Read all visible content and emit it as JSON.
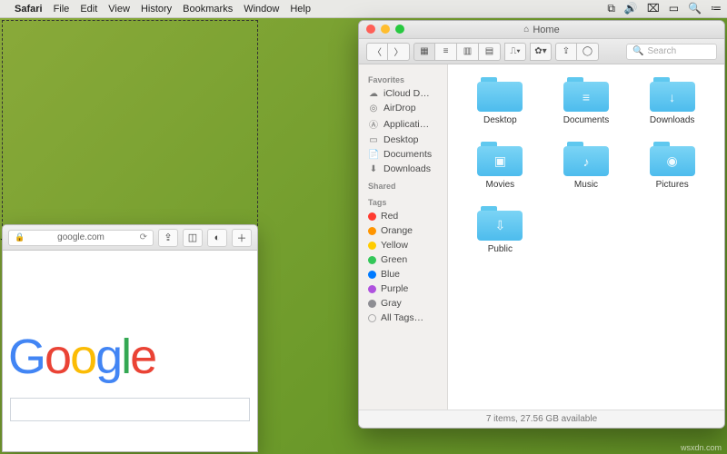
{
  "menubar": {
    "app_name": "Safari",
    "items": [
      "File",
      "Edit",
      "View",
      "History",
      "Bookmarks",
      "Window",
      "Help"
    ],
    "tray_icons": [
      "screen-record-icon",
      "volume-icon",
      "wifi-icon",
      "battery-icon",
      "spotlight-icon",
      "menu-extras-icon"
    ]
  },
  "safari": {
    "url_display": "google.com",
    "logo_letters": [
      "G",
      "o",
      "o",
      "g",
      "l",
      "e"
    ],
    "search_value": ""
  },
  "finder": {
    "title": "Home",
    "search_placeholder": "Search",
    "sidebar": {
      "sections": [
        {
          "header": "Favorites",
          "items": [
            {
              "icon": "cloud",
              "label": "iCloud D…"
            },
            {
              "icon": "airdrop",
              "label": "AirDrop"
            },
            {
              "icon": "apps",
              "label": "Applicati…"
            },
            {
              "icon": "desktop",
              "label": "Desktop"
            },
            {
              "icon": "doc",
              "label": "Documents"
            },
            {
              "icon": "down",
              "label": "Downloads"
            }
          ]
        },
        {
          "header": "Shared",
          "items": []
        },
        {
          "header": "Tags",
          "items": [
            {
              "color": "#ff3b30",
              "label": "Red"
            },
            {
              "color": "#ff9500",
              "label": "Orange"
            },
            {
              "color": "#ffcc00",
              "label": "Yellow"
            },
            {
              "color": "#34c759",
              "label": "Green"
            },
            {
              "color": "#007aff",
              "label": "Blue"
            },
            {
              "color": "#af52de",
              "label": "Purple"
            },
            {
              "color": "#8e8e93",
              "label": "Gray"
            },
            {
              "color": "",
              "label": "All Tags…"
            }
          ]
        }
      ]
    },
    "folders": [
      {
        "name": "Desktop",
        "glyph": ""
      },
      {
        "name": "Documents",
        "glyph": "≡"
      },
      {
        "name": "Downloads",
        "glyph": "↓"
      },
      {
        "name": "Movies",
        "glyph": "▣"
      },
      {
        "name": "Music",
        "glyph": "♪"
      },
      {
        "name": "Pictures",
        "glyph": "◉"
      },
      {
        "name": "Public",
        "glyph": "⇩"
      }
    ],
    "status": "7 items, 27.56 GB available"
  },
  "watermark": "wsxdn.com"
}
